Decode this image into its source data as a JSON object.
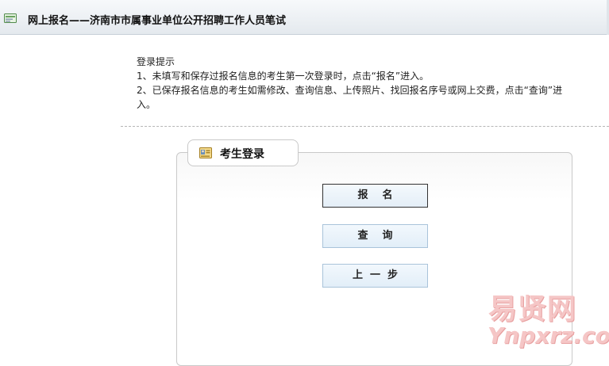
{
  "header": {
    "title": "网上报名——济南市市属事业单位公开招聘工作人员笔试",
    "cut_text": "",
    "icon": "register-form-icon"
  },
  "tips": {
    "heading": "登录提示",
    "line1": "1、未填写和保存过报名信息的考生第一次登录时，点击“报名”进入。",
    "line2a": "2、已保存报名信息的考生如需修改、查询信息、上传照片、找回报名序号或网上交费，点击“查询”进",
    "line2b": "入。"
  },
  "login": {
    "tab_label": "考生登录",
    "tab_icon": "id-card-icon",
    "register_label": "报    名",
    "query_label": "查    询",
    "back_label": "上  一  步"
  },
  "watermark": {
    "cn": "易贤网",
    "en": "Ynpxrz.com"
  },
  "colors": {
    "header_bg": "#e4e9ee",
    "button_border": "#a9c3da",
    "watermark": "#f5c6c6"
  }
}
